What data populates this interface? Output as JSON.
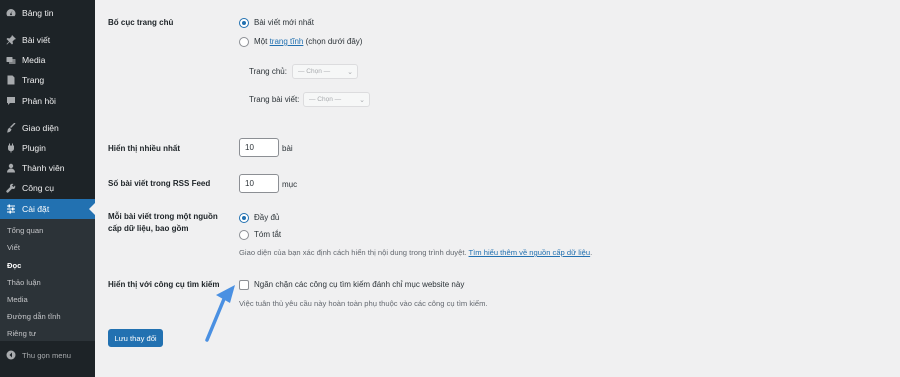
{
  "sidebar": {
    "items": [
      {
        "label": "Bảng tin",
        "icon": "dashboard-icon"
      },
      {
        "label": "Bài viết",
        "icon": "pin-icon"
      },
      {
        "label": "Media",
        "icon": "media-icon"
      },
      {
        "label": "Trang",
        "icon": "page-icon"
      },
      {
        "label": "Phản hồi",
        "icon": "comment-icon"
      },
      {
        "label": "Giao diện",
        "icon": "brush-icon"
      },
      {
        "label": "Plugin",
        "icon": "plugin-icon"
      },
      {
        "label": "Thành viên",
        "icon": "users-icon"
      },
      {
        "label": "Công cụ",
        "icon": "wrench-icon"
      },
      {
        "label": "Cài đặt",
        "icon": "settings-icon"
      }
    ],
    "submenu": [
      "Tổng quan",
      "Viết",
      "Đọc",
      "Thảo luận",
      "Media",
      "Đường dẫn tĩnh",
      "Riêng tư"
    ],
    "collapse_label": "Thu gọn menu",
    "accent": "#2271b1"
  },
  "settings": {
    "homepage": {
      "label": "Bố cục trang chủ",
      "option_latest": "Bài viết mới nhất",
      "option_static_prefix": "Một",
      "option_static_link": "trang tĩnh",
      "option_static_suffix": "(chọn dưới đây)",
      "homepage_label": "Trang chủ:",
      "posts_page_label": "Trang bài viết:",
      "select_placeholder": "— Chọn —"
    },
    "posts_per_page": {
      "label": "Hiển thị nhiều nhất",
      "value": "10",
      "unit": "bài"
    },
    "rss_items": {
      "label": "Số bài viết trong RSS Feed",
      "value": "10",
      "unit": "mục"
    },
    "feed_content": {
      "label_line1": "Mỗi bài viết trong một nguồn",
      "label_line2": "cấp dữ liệu, bao gồm",
      "option_full": "Đầy đủ",
      "option_summary": "Tóm tắt",
      "description": "Giao diện của bạn xác định cách hiển thị nội dung trong trình duyệt.",
      "description_link": "Tìm hiểu thêm về nguồn cấp dữ liệu"
    },
    "search_visibility": {
      "label": "Hiển thị với công cụ tìm kiếm",
      "checkbox_label": "Ngăn chặn các công cụ tìm kiếm đánh chỉ mục website này",
      "note": "Việc tuân thủ yêu cầu này hoàn toàn phụ thuộc vào các công cụ tìm kiếm."
    },
    "save_label": "Lưu thay đổi"
  }
}
